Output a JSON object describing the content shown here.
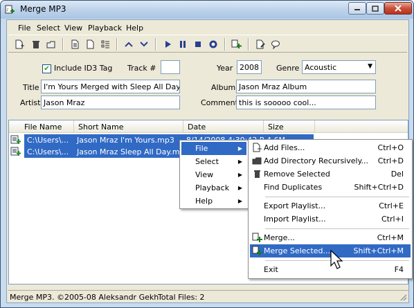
{
  "window": {
    "title": "Merge MP3"
  },
  "menubar": [
    "File",
    "Select",
    "View",
    "Playback",
    "Help"
  ],
  "tags": {
    "include_id3_label": "Include ID3 Tag",
    "include_id3_checked": true,
    "track_label": "Track #",
    "track_value": "",
    "year_label": "Year",
    "year_value": "2008",
    "genre_label": "Genre",
    "genre_value": "Acoustic",
    "title_label": "Title",
    "title_value": "I'm Yours Merged with Sleep All Day",
    "album_label": "Album",
    "album_value": "Jason Mraz Album",
    "artist_label": "Artist",
    "artist_value": "Jason Mraz",
    "comment_label": "Comment",
    "comment_value": "this is sooooo cool..."
  },
  "list": {
    "columns": [
      "File Name",
      "Short Name",
      "Date",
      "Size"
    ],
    "rows": [
      {
        "file": "C:\\Users\\...",
        "short": "Jason Mraz I'm Yours.mp3",
        "date": "8/14/2008 4:30:43 PM",
        "size": "4.6M"
      },
      {
        "file": "C:\\Users\\...",
        "short": "Jason Mraz Sleep All Day.mp3",
        "date": "",
        "size": ""
      }
    ]
  },
  "context_menu": {
    "items": [
      "File",
      "Select",
      "View",
      "Playback",
      "Help"
    ]
  },
  "file_submenu": {
    "items": [
      {
        "label": "Add Files...",
        "shortcut": "Ctrl+O",
        "icon": "add-files-icon"
      },
      {
        "label": "Add Directory Recursively...",
        "shortcut": "Ctrl+D",
        "icon": "folder-icon"
      },
      {
        "label": "Remove Selected",
        "shortcut": "Del",
        "icon": "trash-icon"
      },
      {
        "label": "Find Duplicates",
        "shortcut": "Shift+Ctrl+D",
        "icon": ""
      },
      {
        "label": "Export Playlist...",
        "shortcut": "Ctrl+E",
        "icon": ""
      },
      {
        "label": "Import Playlist...",
        "shortcut": "Ctrl+I",
        "icon": ""
      },
      {
        "label": "Merge...",
        "shortcut": "Ctrl+M",
        "icon": "merge-icon"
      },
      {
        "label": "Merge Selected...",
        "shortcut": "Shift+Ctrl+M",
        "icon": "merge-selected-icon"
      },
      {
        "label": "Exit",
        "shortcut": "F4",
        "icon": ""
      }
    ]
  },
  "status": {
    "copyright": "Merge MP3. ©2005-08 Aleksandr Gekh",
    "total_files": "Total Files: 2"
  },
  "colors": {
    "selection": "#316ac5",
    "chrome": "#ece9d8"
  }
}
